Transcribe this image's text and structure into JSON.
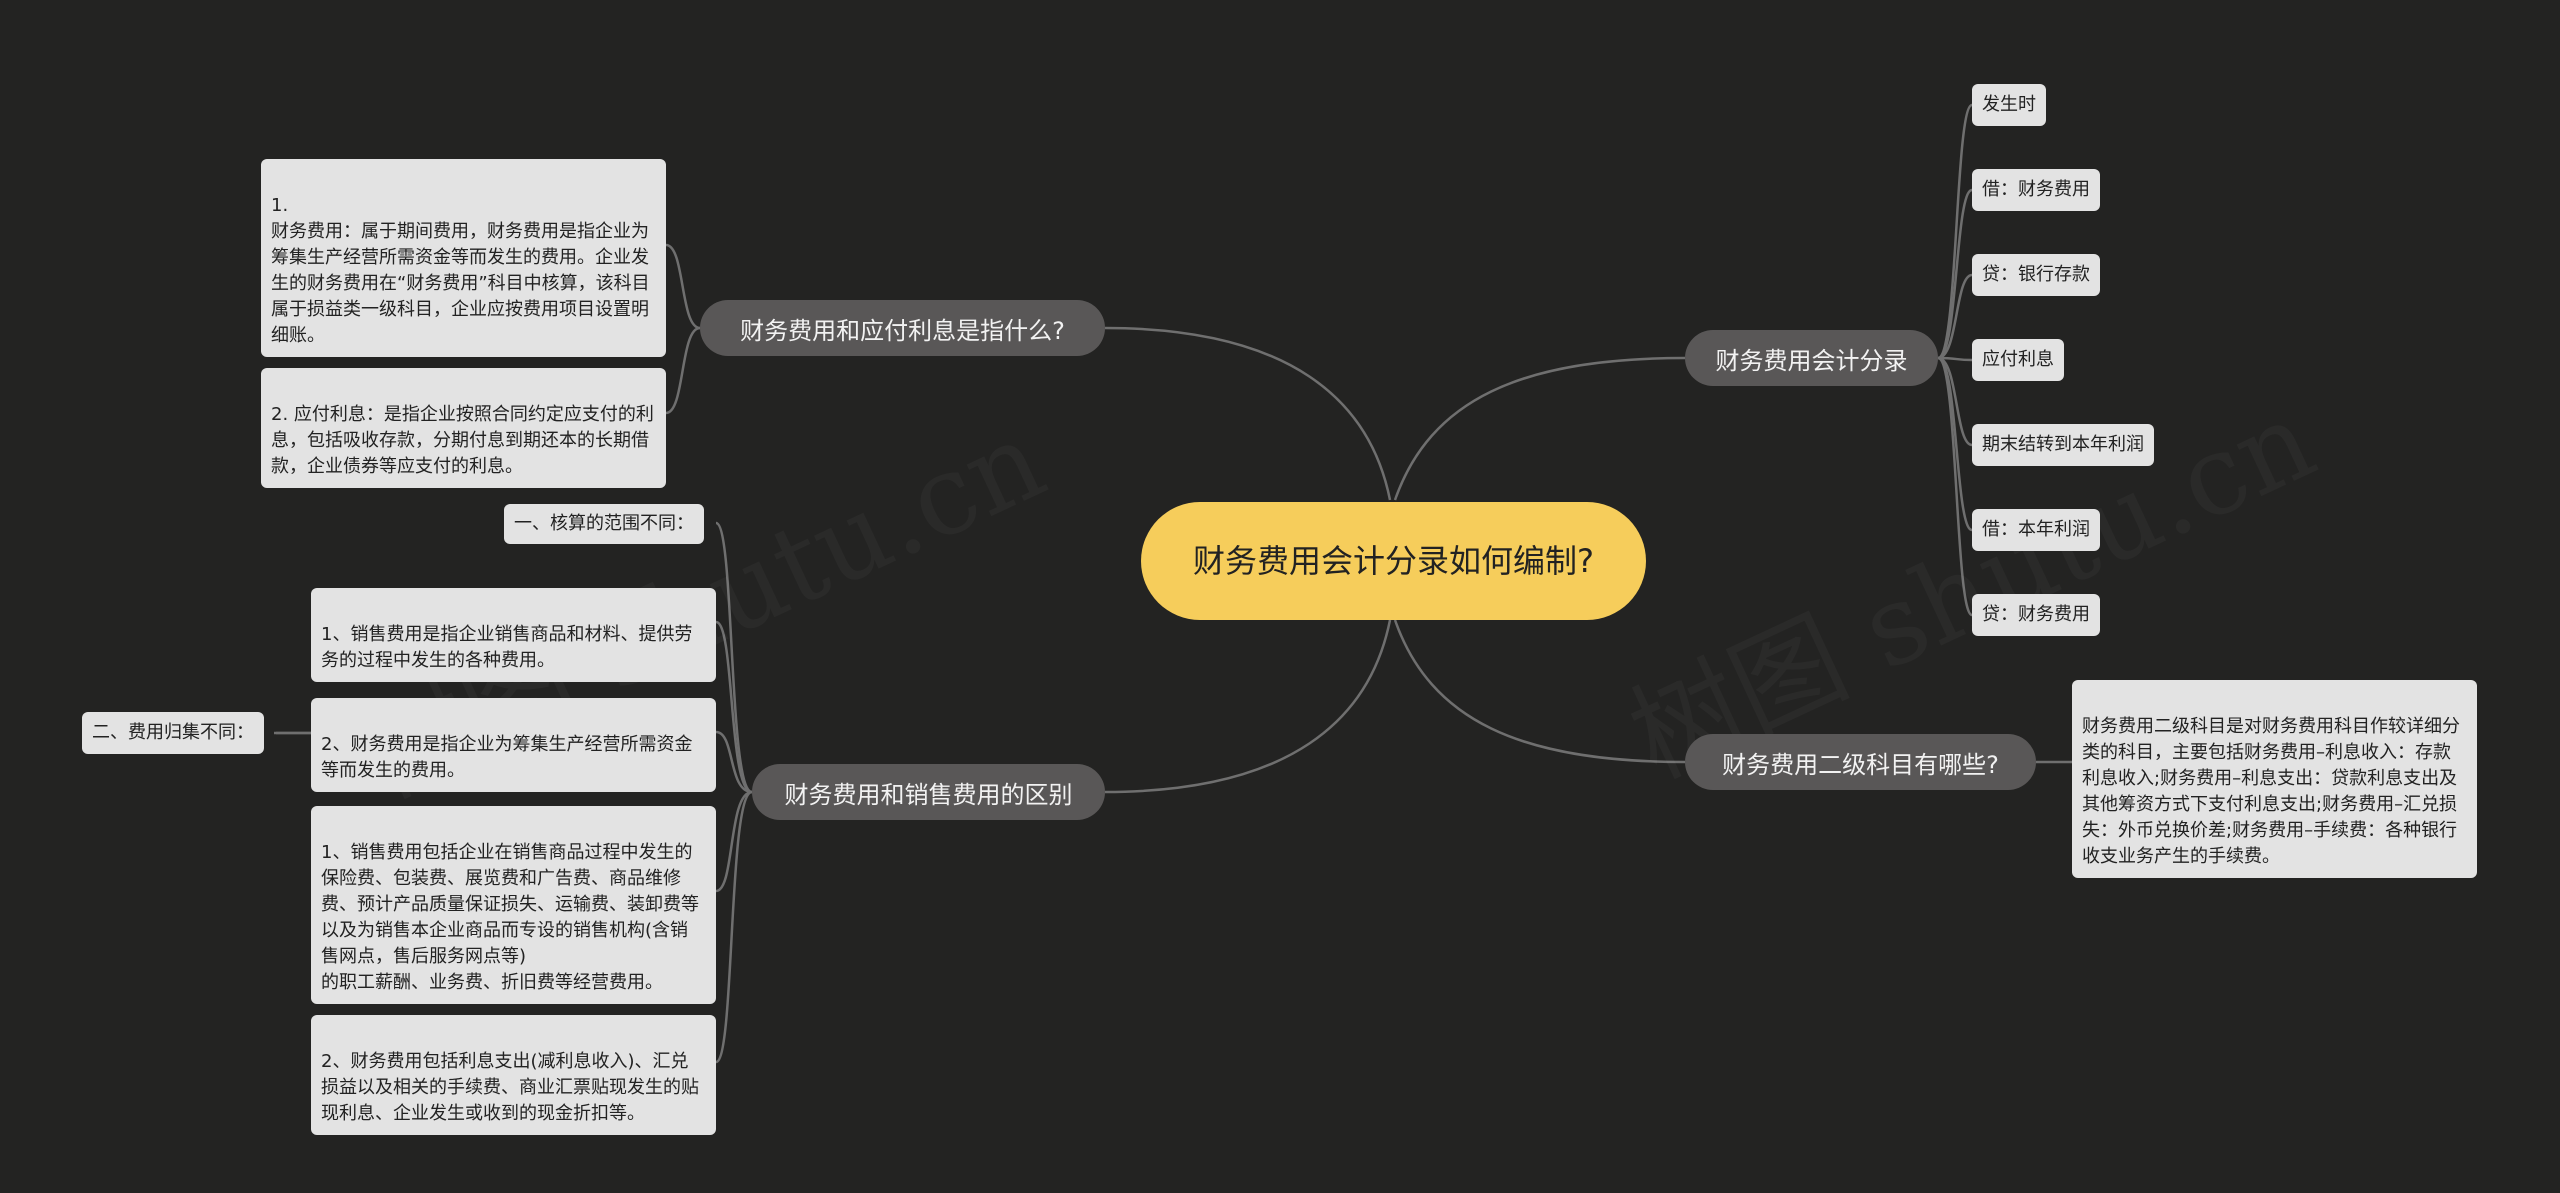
{
  "central": {
    "label": "财务费用会计分录如何编制?"
  },
  "branches": {
    "right_top": {
      "label": "财务费用会计分录",
      "items": [
        "发生时",
        "借：财务费用",
        "贷：银行存款",
        "应付利息",
        "期末结转到本年利润",
        "借：本年利润",
        "贷：财务费用"
      ]
    },
    "right_bottom": {
      "label": "财务费用二级科目有哪些?",
      "text": "财务费用二级科目是对财务费用科目作较详细分类的科目，主要包括财务费用–利息收入：存款利息收入;财务费用–利息支出：贷款利息支出及其他筹资方式下支付利息支出;财务费用–汇兑损失：外币兑换价差;财务费用–手续费：各种银行收支业务产生的手续费。"
    },
    "left_top": {
      "label": "财务费用和应付利息是指什么?",
      "items": [
        "1.\n财务费用：属于期间费用，财务费用是指企业为筹集生产经营所需资金等而发生的费用。企业发生的财务费用在“财务费用”科目中核算，该科目属于损益类一级科目，企业应按费用项目设置明细账。",
        "2. 应付利息：是指企业按照合同约定应支付的利息，包括吸收存款，分期付息到期还本的长期借款，企业债券等应支付的利息。"
      ]
    },
    "left_bottom": {
      "label": "财务费用和销售费用的区别",
      "items": [
        "一、核算的范围不同：",
        "1、销售费用是指企业销售商品和材料、提供劳务的过程中发生的各种费用。",
        "2、财务费用是指企业为筹集生产经营所需资金等而发生的费用。",
        "1、销售费用包括企业在销售商品过程中发生的保险费、包装费、展览费和广告费、商品维修费、预计产品质量保证损失、运输费、装卸费等以及为销售本企业商品而专设的销售机构(含销售网点，售后服务网点等)\n的职工薪酬、业务费、折旧费等经营费用。",
        "2、财务费用包括利息支出(减利息收入)、汇兑损益以及相关的手续费、商业汇票贴现发生的贴现利息、企业发生或收到的现金折扣等。"
      ],
      "group_label": "二、费用归集不同："
    }
  },
  "colors": {
    "background": "#232322",
    "central": "#f6cd5b",
    "branch": "#595757",
    "leaf": "#e3e3e3",
    "line": "#6f6f6f"
  }
}
